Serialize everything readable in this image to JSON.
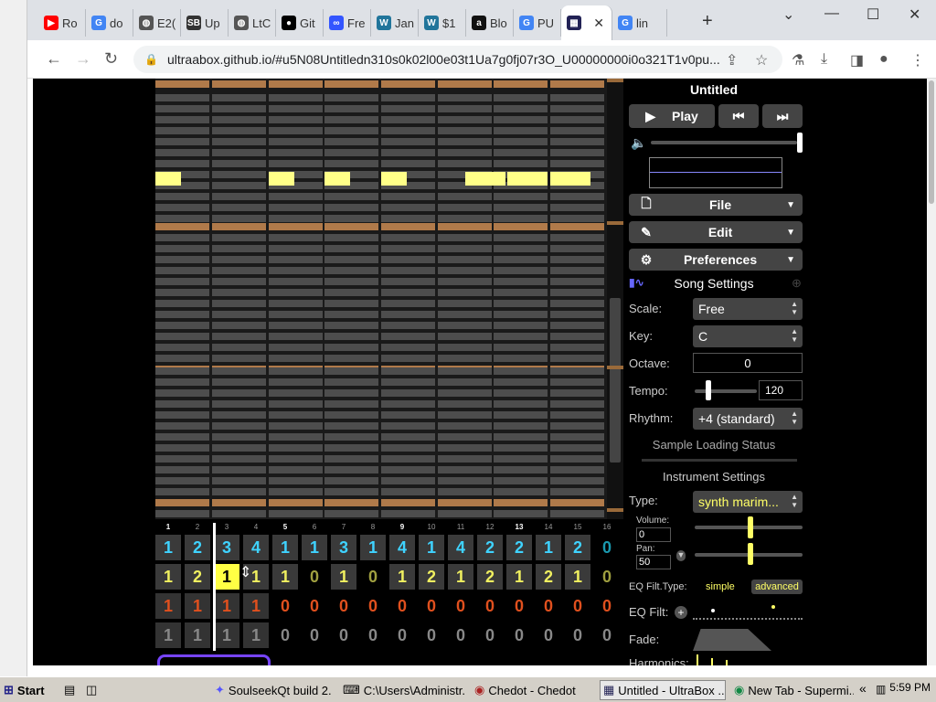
{
  "browser": {
    "tabs": [
      {
        "label": "Ro",
        "icon": "youtube-icon",
        "color": "#ff0000",
        "glyph": "▶"
      },
      {
        "label": "do",
        "icon": "google-icon",
        "color": "#4285f4",
        "glyph": "G"
      },
      {
        "label": "E2(",
        "icon": "globe-icon",
        "color": "#555555",
        "glyph": "◍"
      },
      {
        "label": "Up",
        "icon": "sb-icon",
        "color": "#333333",
        "glyph": "SB"
      },
      {
        "label": "LtC",
        "icon": "globe-icon",
        "color": "#555555",
        "glyph": "◍"
      },
      {
        "label": "Git",
        "icon": "github-icon",
        "color": "#000000",
        "glyph": "●"
      },
      {
        "label": "Fre",
        "icon": "infinity-icon",
        "color": "#3355ff",
        "glyph": "∞"
      },
      {
        "label": "Jan",
        "icon": "wordpress-icon",
        "color": "#21759b",
        "glyph": "W"
      },
      {
        "label": "$1",
        "icon": "wordpress-icon",
        "color": "#21759b",
        "glyph": "W"
      },
      {
        "label": "Blo",
        "icon": "amazon-icon",
        "color": "#111111",
        "glyph": "a"
      },
      {
        "label": "PU",
        "icon": "google-icon",
        "color": "#4285f4",
        "glyph": "G"
      },
      {
        "label": "",
        "icon": "ultrabox-icon",
        "color": "#222255",
        "glyph": "▦",
        "active": true
      },
      {
        "label": "lin",
        "icon": "google-icon",
        "color": "#4285f4",
        "glyph": "G"
      }
    ],
    "url": "ultraabox.github.io/#u5N08Untitledn310s0k02l00e03t1Ua7g0fj07r3O_U00000000i0o321T1v0pu..."
  },
  "app": {
    "title": "Untitled",
    "play_label": "Play",
    "menus": [
      {
        "label": "File",
        "icon": "file-icon"
      },
      {
        "label": "Edit",
        "icon": "pencil-icon"
      },
      {
        "label": "Preferences",
        "icon": "gear-icon"
      }
    ],
    "song_settings": {
      "header": "Song Settings",
      "scale_label": "Scale:",
      "scale_value": "Free",
      "key_label": "Key:",
      "key_value": "C",
      "octave_label": "Octave:",
      "octave_value": "0",
      "tempo_label": "Tempo:",
      "tempo_value": "120",
      "rhythm_label": "Rhythm:",
      "rhythm_value": "+4 (standard)"
    },
    "sample_status": "Sample Loading Status",
    "instrument": {
      "header": "Instrument Settings",
      "type_label": "Type:",
      "type_value": "synth marim...",
      "volume_label": "Volume:",
      "volume_value": "0",
      "pan_label": "Pan:",
      "pan_value": "50",
      "eq_type_label": "EQ Filt.Type:",
      "eq_simple": "simple",
      "eq_advanced": "advanced",
      "eq_label": "EQ Filt:",
      "fade_label": "Fade:",
      "harmonics_label": "Harmonics:"
    },
    "bar_numbers": [
      "1",
      "2",
      "3",
      "4",
      "5",
      "6",
      "7",
      "8",
      "9",
      "10",
      "11",
      "12",
      "13",
      "14",
      "15",
      "16"
    ],
    "patterns": [
      {
        "color": "#3fd3ff",
        "values": [
          "1",
          "2",
          "3",
          "4",
          "1",
          "1",
          "3",
          "1",
          "4",
          "1",
          "4",
          "2",
          "2",
          "1",
          "2",
          "0"
        ]
      },
      {
        "color": "#f0f060",
        "values": [
          "1",
          "2",
          "1",
          "1",
          "1",
          "0",
          "1",
          "0",
          "1",
          "2",
          "1",
          "2",
          "1",
          "2",
          "1",
          "0"
        ]
      },
      {
        "color": "#e0501e",
        "values": [
          "1",
          "1",
          "1",
          "1",
          "0",
          "0",
          "0",
          "0",
          "0",
          "0",
          "0",
          "0",
          "0",
          "0",
          "0",
          "0"
        ]
      },
      {
        "color": "#888888",
        "values": [
          "1",
          "1",
          "1",
          "1",
          "0",
          "0",
          "0",
          "0",
          "0",
          "0",
          "0",
          "0",
          "0",
          "0",
          "0",
          "0"
        ]
      }
    ]
  },
  "taskbar": {
    "start": "Start",
    "items": [
      "SoulseekQt build 2...",
      "C:\\Users\\Administr...",
      "Chedot - Chedot",
      "Untitled - UltraBox ...",
      "New Tab - Supermi..."
    ],
    "clock": "5:59 PM"
  }
}
